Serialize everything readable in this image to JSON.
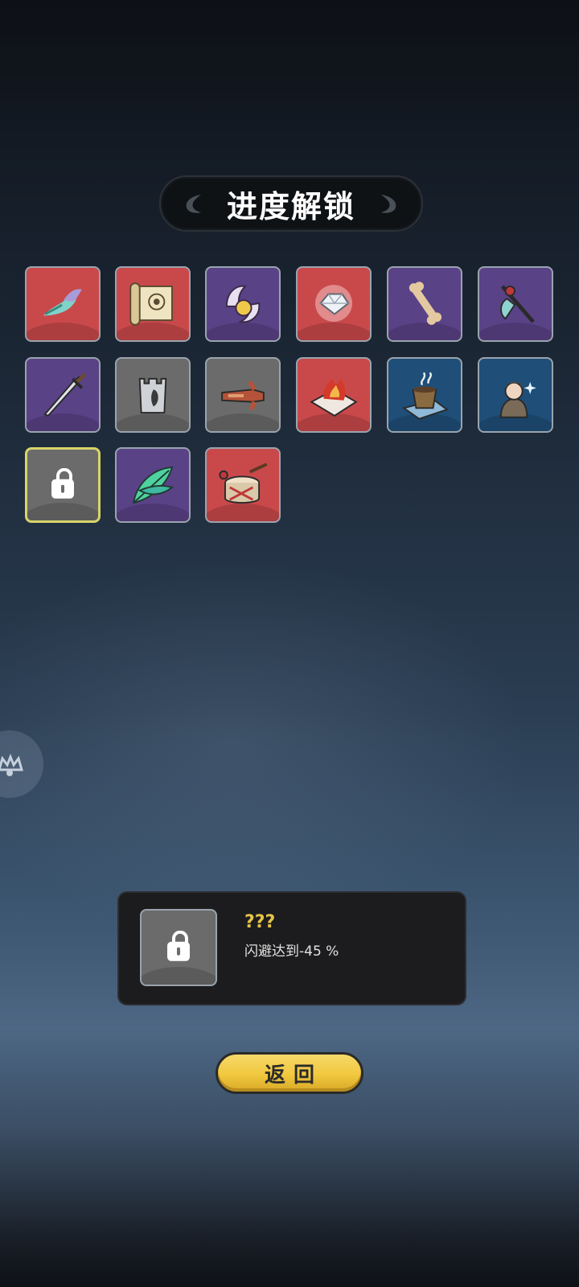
{
  "title": "进度解锁",
  "items": [
    {
      "icon": "spirit-flame-icon",
      "rarity": "red"
    },
    {
      "icon": "scroll-map-icon",
      "rarity": "red"
    },
    {
      "icon": "claw-orb-icon",
      "rarity": "purple"
    },
    {
      "icon": "diamond-gem-icon",
      "rarity": "red"
    },
    {
      "icon": "bone-icon",
      "rarity": "purple"
    },
    {
      "icon": "spear-icon",
      "rarity": "purple"
    },
    {
      "icon": "dagger-icon",
      "rarity": "purple"
    },
    {
      "icon": "stone-tower-icon",
      "rarity": "gray"
    },
    {
      "icon": "wooden-gloves-icon",
      "rarity": "gray"
    },
    {
      "icon": "fire-bundle-icon",
      "rarity": "red"
    },
    {
      "icon": "tea-cup-icon",
      "rarity": "blue"
    },
    {
      "icon": "mage-portrait-icon",
      "rarity": "blue"
    },
    {
      "icon": "lock-icon",
      "rarity": "locked"
    },
    {
      "icon": "feather-icon",
      "rarity": "purple"
    },
    {
      "icon": "war-drum-icon",
      "rarity": "red"
    }
  ],
  "selected": {
    "name": "???",
    "description": "闪避达到-45 %"
  },
  "back_button": "返回",
  "colors": {
    "red": "#c9494b",
    "purple": "#5a4287",
    "gray": "#6b6b6b",
    "blue": "#1f4f78",
    "locked_border": "#d8d46a",
    "title_gold": "#e6c24a"
  }
}
